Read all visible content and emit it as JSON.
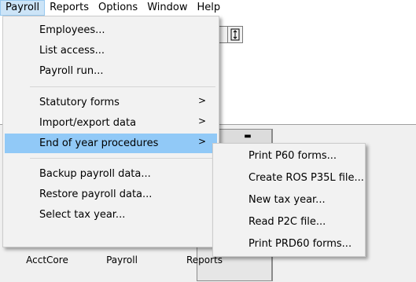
{
  "menubar": [
    "Payroll",
    "Reports",
    "Options",
    "Window",
    "Help"
  ],
  "dropdown": {
    "group1": [
      "Employees...",
      "List access...",
      "Payroll run..."
    ],
    "group2": [
      "Statutory forms",
      "Import/export data",
      "End of year procedures"
    ],
    "group3": [
      "Backup payroll data...",
      "Restore payroll data...",
      "Select tax year..."
    ],
    "submenu_arrow": ">"
  },
  "submenu": [
    "Print P60 forms...",
    "Create ROS P35L file...",
    "New tax year...",
    "Read P2C file...",
    "Print PRD60 forms..."
  ],
  "desktop_icons": [
    "AcctCore",
    "Payroll",
    "Reports"
  ],
  "colors": {
    "highlight": "#91c9f7",
    "menu_bg": "#f2f2f2",
    "open_menu": "#cce4f7"
  }
}
